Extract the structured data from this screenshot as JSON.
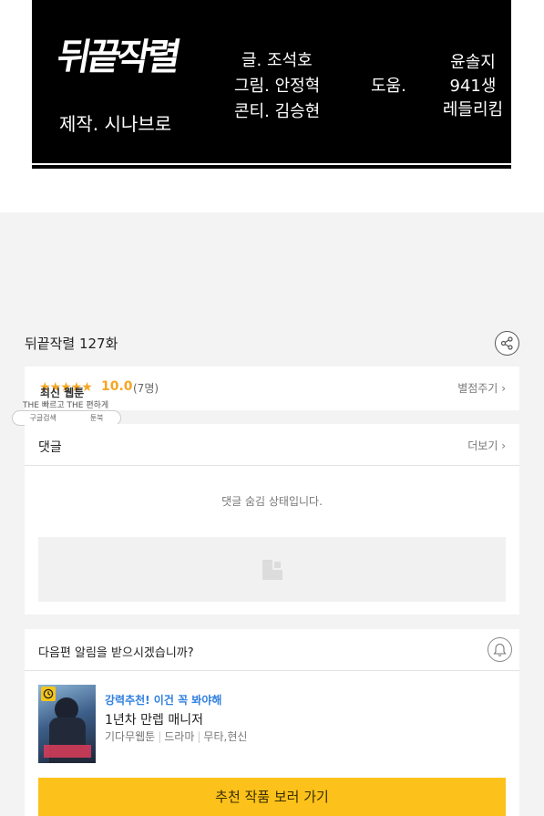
{
  "credits": {
    "logo": "뒤끝작렬",
    "production": "제작. 시나브로",
    "story": "글. 조석호",
    "art": "그림. 안정혁",
    "storyboard": "콘티. 김승현",
    "assist_label": "도움.",
    "assistants": [
      "윤솔지",
      "941생",
      "레들리킴"
    ]
  },
  "episode": {
    "title": "뒤끝작렬 127화"
  },
  "rating": {
    "stars": "★★★★★",
    "score": "10.0",
    "count": "(7명)",
    "rate_link": "별점주기",
    "chevron": "›"
  },
  "ad": {
    "title": "최신 웹툰",
    "subtitle": "THE 빠르고 THE 편하게",
    "google": "구글검색",
    "toonbook": "툰북"
  },
  "comments": {
    "label": "댓글",
    "more": "더보기",
    "hidden_message": "댓글 숨김 상태입니다."
  },
  "notify": {
    "question": "다음편 알림을 받으시겠습니까?"
  },
  "recommend": {
    "tag": "강력추천! 이건 꼭 봐야해",
    "title": "1년차 만렙 매니저",
    "genres": [
      "기다무웹툰",
      "드라마",
      "무타,현신"
    ],
    "cta": "추천 작품 보러 가기"
  },
  "colors": {
    "star": "#f5a623",
    "tag": "#2f7fe0",
    "cta": "#fcc21b"
  }
}
